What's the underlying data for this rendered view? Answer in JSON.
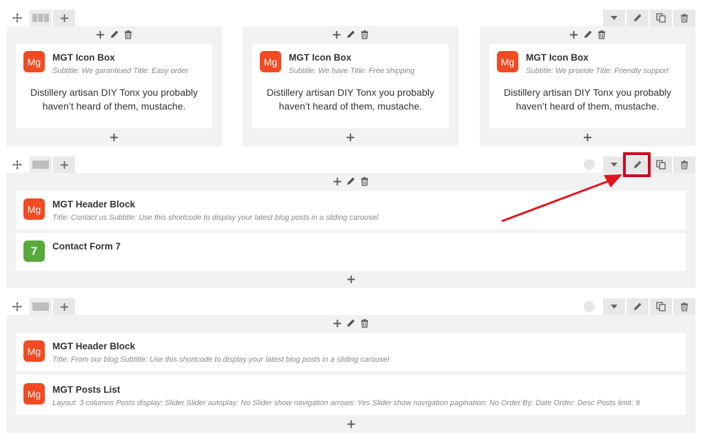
{
  "rows": [
    {
      "columns": [
        {
          "element": {
            "badge": "Mg",
            "title": "MGT Icon Box",
            "subtitle": "Subtitle: We garantiued  Title: Easy order",
            "text": "Distillery artisan DIY Tonx you probably haven’t heard of them, mustache."
          }
        },
        {
          "element": {
            "badge": "Mg",
            "title": "MGT Icon Box",
            "subtitle": "Subtitle: We have  Title: Free shipping",
            "text": "Distillery artisan DIY Tonx you probably haven’t heard of them, mustache."
          }
        },
        {
          "element": {
            "badge": "Mg",
            "title": "MGT Icon Box",
            "subtitle": "Subtitle: We provide  Title: Friendly support",
            "text": "Distillery artisan DIY Tonx you probably haven’t heard of them, mustache."
          }
        }
      ]
    },
    {
      "elements": [
        {
          "badge": "Mg",
          "title": "MGT Header Block",
          "subtitle": "Title: Contact us  Subtitle: Use this shortcode to display your latest blog posts in a sliding carousel"
        },
        {
          "badge": "7",
          "title": "Contact Form 7",
          "subtitle": ""
        }
      ]
    },
    {
      "elements": [
        {
          "badge": "Mg",
          "title": "MGT Header Block",
          "subtitle": "Title: From our blog  Subtitle: Use this shortcode to display your latest blog posts in a sliding carousel"
        },
        {
          "badge": "Mg",
          "title": "MGT Posts List",
          "subtitle": "Layout: 3 columns  Posts display: Slider  Slider autoplay: No  Slider show navigation arrows: Yes  Slider show navigation pagination: No  Order By: Date  Order: Desc  Posts limit: 9"
        }
      ]
    }
  ],
  "icons": {
    "move": "move-icon",
    "layout": "columns-layout-icon",
    "add": "plus-icon",
    "toggle": "chevron-down-icon",
    "edit": "pencil-icon",
    "clone": "clone-icon",
    "delete": "trash-icon"
  },
  "colors": {
    "mg_badge": "#f24a22",
    "cf7_badge": "#56a93a",
    "highlight": "#d0021b",
    "row_bg": "#f2f2f2"
  }
}
